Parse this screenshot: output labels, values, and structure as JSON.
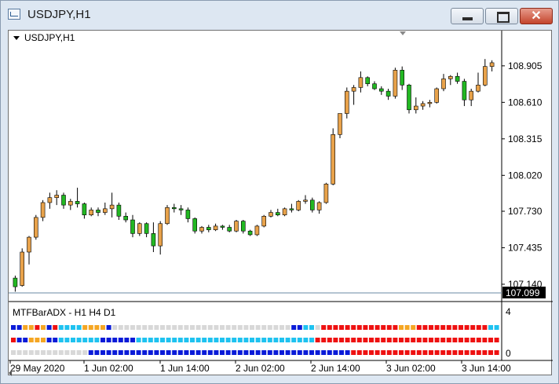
{
  "window": {
    "title": "USDJPY,H1",
    "minimize_label": "",
    "maximize_label": "",
    "close_label": "✕"
  },
  "chart": {
    "header_label": "USDJPY,H1",
    "current_price": "107.099",
    "indicator_label": "MTFBarADX - H1 H4 D1",
    "indicator_max": "4",
    "indicator_min": "0",
    "colors": {
      "bull": "#E8A24A",
      "bear": "#22B822",
      "wick": "#000000",
      "price_tag_bg": "#000000",
      "price_tag_fg": "#FFFFFF",
      "red": "#EE1111",
      "orange": "#F5A623",
      "lightblue": "#1EC2F0",
      "blue": "#0A1BD8",
      "gray": "#D8D8D8"
    }
  },
  "chart_data": {
    "type": "candlestick",
    "title": "USDJPY,H1",
    "y_axis": {
      "ticks": [
        "108.905",
        "108.610",
        "108.315",
        "108.020",
        "107.730",
        "107.435",
        "107.140"
      ],
      "range": [
        107.07,
        109.05
      ]
    },
    "x_axis": {
      "ticks": [
        "29 May 2020",
        "1 Jun 02:00",
        "1 Jun 14:00",
        "2 Jun 02:00",
        "2 Jun 14:00",
        "3 Jun 02:00",
        "3 Jun 14:00"
      ]
    },
    "candles": [
      [
        107.19,
        107.21,
        107.08,
        107.12
      ],
      [
        107.13,
        107.43,
        107.12,
        107.4
      ],
      [
        107.4,
        107.53,
        107.3,
        107.52
      ],
      [
        107.52,
        107.7,
        107.5,
        107.68
      ],
      [
        107.68,
        107.82,
        107.65,
        107.8
      ],
      [
        107.8,
        107.88,
        107.75,
        107.84
      ],
      [
        107.84,
        107.9,
        107.78,
        107.86
      ],
      [
        107.86,
        107.88,
        107.75,
        107.78
      ],
      [
        107.78,
        107.83,
        107.74,
        107.81
      ],
      [
        107.81,
        107.92,
        107.76,
        107.79
      ],
      [
        107.79,
        107.8,
        107.67,
        107.7
      ],
      [
        107.7,
        107.76,
        107.69,
        107.74
      ],
      [
        107.74,
        107.76,
        107.69,
        107.72
      ],
      [
        107.72,
        107.8,
        107.7,
        107.75
      ],
      [
        107.75,
        107.88,
        107.68,
        107.78
      ],
      [
        107.78,
        107.8,
        107.66,
        107.69
      ],
      [
        107.69,
        107.72,
        107.64,
        107.66
      ],
      [
        107.66,
        107.7,
        107.52,
        107.55
      ],
      [
        107.55,
        107.64,
        107.53,
        107.63
      ],
      [
        107.63,
        107.64,
        107.52,
        107.55
      ],
      [
        107.55,
        107.64,
        107.4,
        107.45
      ],
      [
        107.45,
        107.65,
        107.38,
        107.63
      ],
      [
        107.63,
        107.78,
        107.62,
        107.76
      ],
      [
        107.76,
        107.79,
        107.72,
        107.75
      ],
      [
        107.75,
        107.78,
        107.7,
        107.74
      ],
      [
        107.74,
        107.76,
        107.64,
        107.67
      ],
      [
        107.67,
        107.68,
        107.55,
        107.57
      ],
      [
        107.57,
        107.61,
        107.55,
        107.6
      ],
      [
        107.6,
        107.62,
        107.56,
        107.58
      ],
      [
        107.58,
        107.63,
        107.57,
        107.61
      ],
      [
        107.61,
        107.62,
        107.58,
        107.6
      ],
      [
        107.6,
        107.62,
        107.56,
        107.57
      ],
      [
        107.57,
        107.66,
        107.56,
        107.65
      ],
      [
        107.65,
        107.66,
        107.55,
        107.57
      ],
      [
        107.57,
        107.58,
        107.53,
        107.54
      ],
      [
        107.54,
        107.62,
        107.53,
        107.61
      ],
      [
        107.61,
        107.7,
        107.6,
        107.69
      ],
      [
        107.69,
        107.74,
        107.68,
        107.72
      ],
      [
        107.72,
        107.75,
        107.69,
        107.7
      ],
      [
        107.7,
        107.76,
        107.69,
        107.75
      ],
      [
        107.75,
        107.79,
        107.72,
        107.74
      ],
      [
        107.74,
        107.82,
        107.73,
        107.81
      ],
      [
        107.81,
        107.86,
        107.79,
        107.82
      ],
      [
        107.82,
        107.84,
        107.72,
        107.74
      ],
      [
        107.74,
        107.81,
        107.71,
        107.8
      ],
      [
        107.8,
        107.96,
        107.79,
        107.95
      ],
      [
        107.95,
        108.4,
        107.94,
        108.35
      ],
      [
        108.35,
        108.47,
        108.32,
        108.52
      ],
      [
        108.52,
        108.73,
        108.48,
        108.7
      ],
      [
        108.7,
        108.75,
        108.59,
        108.73
      ],
      [
        108.73,
        108.86,
        108.69,
        108.81
      ],
      [
        108.81,
        108.82,
        108.74,
        108.76
      ],
      [
        108.76,
        108.78,
        108.71,
        108.72
      ],
      [
        108.72,
        108.74,
        108.67,
        108.7
      ],
      [
        108.7,
        108.72,
        108.63,
        108.66
      ],
      [
        108.66,
        108.89,
        108.64,
        108.87
      ],
      [
        108.87,
        108.9,
        108.71,
        108.75
      ],
      [
        108.75,
        108.76,
        108.52,
        108.55
      ],
      [
        108.55,
        108.65,
        108.52,
        108.58
      ],
      [
        108.58,
        108.62,
        108.55,
        108.6
      ],
      [
        108.6,
        108.63,
        108.57,
        108.61
      ],
      [
        108.61,
        108.73,
        108.6,
        108.72
      ],
      [
        108.72,
        108.84,
        108.7,
        108.8
      ],
      [
        108.8,
        108.83,
        108.75,
        108.82
      ],
      [
        108.82,
        108.85,
        108.76,
        108.78
      ],
      [
        108.78,
        108.8,
        108.58,
        108.63
      ],
      [
        108.63,
        108.72,
        108.58,
        108.7
      ],
      [
        108.7,
        108.85,
        108.69,
        108.75
      ],
      [
        108.75,
        108.96,
        108.74,
        108.9
      ],
      [
        108.9,
        108.95,
        108.86,
        108.93
      ]
    ]
  }
}
